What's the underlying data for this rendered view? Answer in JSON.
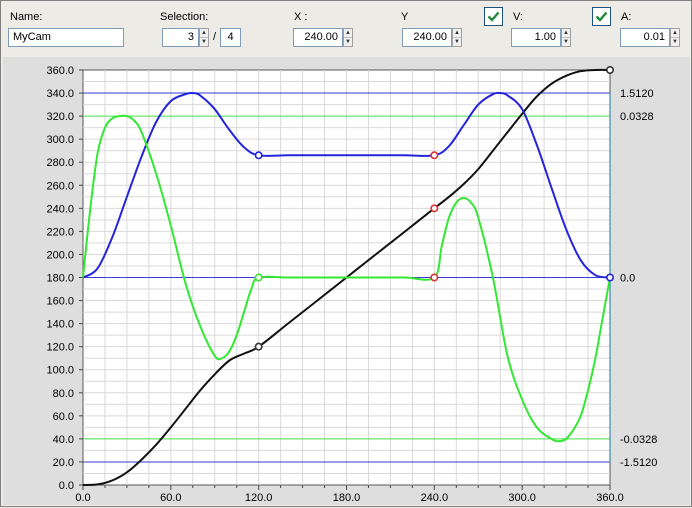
{
  "toolbar": {
    "name_label": "Name:",
    "name_value": "MyCam",
    "selection_label": "Selection:",
    "selection_current": "3",
    "selection_separator": "/",
    "selection_total": "4",
    "x_label": "X :",
    "x_value": "240.00",
    "y_label": "Y",
    "y_value": "240.00",
    "v_label": "V:",
    "v_checked": true,
    "v_value": "1.00",
    "a_label": "A:",
    "a_checked": true,
    "a_value": "0.01",
    "check_color": "#1f8a3a"
  },
  "chart_data": {
    "type": "line",
    "title": "",
    "xlabel": "",
    "ylabel": "",
    "xlim": [
      0,
      360
    ],
    "ylim": [
      0,
      360
    ],
    "x_ticks": [
      "0.0",
      "60.0",
      "120.0",
      "180.0",
      "240.0",
      "300.0",
      "360.0"
    ],
    "y_ticks": [
      "0.0",
      "20.0",
      "40.0",
      "60.0",
      "80.0",
      "100.0",
      "120.0",
      "140.0",
      "160.0",
      "180.0",
      "200.0",
      "220.0",
      "240.0",
      "260.0",
      "280.0",
      "300.0",
      "320.0",
      "340.0",
      "360.0"
    ],
    "grid": true,
    "right_axis_labels": [
      {
        "text": "1.5120",
        "y": 340,
        "color": "#2222dd"
      },
      {
        "text": "0.0328",
        "y": 320,
        "color": "#22c722"
      },
      {
        "text": "0.0",
        "y": 180,
        "color": "#2222dd"
      },
      {
        "text": "-0.0328",
        "y": 40,
        "color": "#22c722"
      },
      {
        "text": "-1.5120",
        "y": 20,
        "color": "#2222dd"
      }
    ],
    "reference_lines": [
      {
        "y": 340,
        "color": "#3a3adb"
      },
      {
        "y": 320,
        "color": "#4ce64c"
      },
      {
        "y": 180,
        "color": "#3a3adb"
      },
      {
        "y": 40,
        "color": "#4ce64c"
      },
      {
        "y": 20,
        "color": "#3a3adb"
      }
    ],
    "series": [
      {
        "color": "#111111",
        "x": [
          0,
          10,
          20,
          30,
          40,
          50,
          60,
          70,
          80,
          90,
          100,
          110,
          120,
          140,
          160,
          180,
          200,
          220,
          240,
          250,
          260,
          270,
          280,
          290,
          300,
          310,
          320,
          330,
          340,
          350,
          360
        ],
        "y": [
          0,
          0.5,
          4,
          11,
          22,
          35,
          50,
          66,
          82,
          96,
          108,
          114,
          120,
          140,
          160,
          180,
          200,
          220,
          240,
          250,
          261,
          274,
          290,
          306,
          322,
          337,
          348,
          355,
          359,
          360,
          360
        ]
      },
      {
        "color": "#2424dc",
        "x": [
          0,
          10,
          20,
          30,
          40,
          50,
          60,
          70,
          75,
          80,
          90,
          100,
          110,
          120,
          140,
          160,
          180,
          200,
          220,
          240,
          250,
          260,
          270,
          280,
          285,
          290,
          300,
          310,
          320,
          330,
          340,
          350,
          360
        ],
        "y": [
          180,
          188,
          215,
          250,
          285,
          315,
          333,
          339,
          340,
          338,
          326,
          308,
          293,
          286,
          286,
          286,
          286,
          286,
          286,
          286,
          294,
          312,
          330,
          339,
          340,
          338,
          326,
          295,
          258,
          222,
          195,
          182,
          180
        ]
      },
      {
        "color": "#33e833",
        "x": [
          0,
          5,
          10,
          15,
          20,
          25,
          30,
          35,
          40,
          50,
          60,
          70,
          80,
          90,
          95,
          100,
          105,
          110,
          115,
          120,
          140,
          160,
          180,
          200,
          220,
          240,
          245,
          250,
          255,
          260,
          265,
          270,
          280,
          290,
          300,
          310,
          320,
          325,
          330,
          335,
          340,
          345,
          350,
          355,
          360
        ],
        "y": [
          180,
          240,
          288,
          310,
          318,
          320,
          320,
          316,
          306,
          270,
          225,
          175,
          138,
          112,
          110,
          116,
          130,
          150,
          170,
          180,
          180,
          180,
          180,
          180,
          180,
          180,
          207,
          232,
          245,
          249,
          245,
          232,
          180,
          112,
          74,
          50,
          40,
          38,
          40,
          48,
          60,
          82,
          110,
          145,
          180
        ]
      }
    ],
    "markers": [
      {
        "x": 120,
        "y": 120,
        "color": "#333333"
      },
      {
        "x": 240,
        "y": 240,
        "color": "#e03030"
      },
      {
        "x": 360,
        "y": 360,
        "color": "#333333"
      },
      {
        "x": 120,
        "y": 286,
        "color": "#2424dc"
      },
      {
        "x": 240,
        "y": 286,
        "color": "#e03030"
      },
      {
        "x": 360,
        "y": 180,
        "color": "#2424dc"
      },
      {
        "x": 120,
        "y": 180,
        "color": "#33e833"
      },
      {
        "x": 240,
        "y": 180,
        "color": "#e03030"
      }
    ]
  }
}
